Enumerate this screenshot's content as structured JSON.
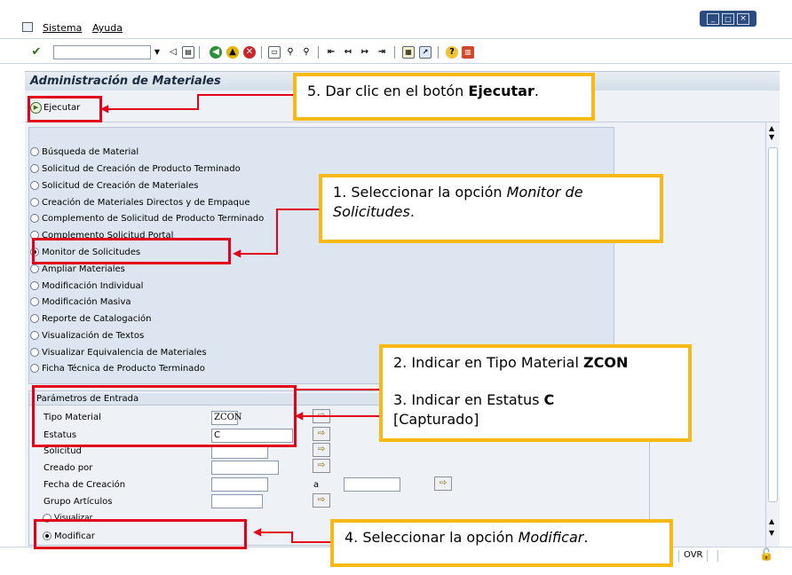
{
  "menu": {
    "sistema": "Sistema",
    "ayuda": "Ayuda"
  },
  "toolbar": {
    "command_placeholder": "",
    "icons": [
      "check-icon",
      "back-icon",
      "save-icon",
      "back-green-icon",
      "exit-icon",
      "cancel-icon",
      "print-icon",
      "find-icon",
      "find-next-icon",
      "first-page-icon",
      "prev-page-icon",
      "next-page-icon",
      "last-page-icon",
      "new-session-icon",
      "shortcut-icon",
      "help-icon",
      "layout-icon"
    ]
  },
  "title": "Administración de Materiales",
  "execute_label": "Ejecutar",
  "options": [
    "Búsqueda de Material",
    "Solicitud de Creación de Producto Terminado",
    "Solicitud de Creación de Materiales",
    "Creación de Materiales Directos y de Empaque",
    "Complemento de Solicitud de Producto Terminado",
    "Complemento Solicitud Portal",
    "Monitor de Solicitudes",
    "Ampliar Materiales",
    "Modificación Individual",
    "Modificación Masiva",
    "Reporte de Catalogación",
    "Visualización de Textos",
    "Visualizar Equivalencia de Materiales",
    "Ficha Técnica de Producto Terminado"
  ],
  "params": {
    "header": "Parámetros de Entrada",
    "tipo_label": "Tipo Material",
    "tipo_value": "ZCON",
    "estatus_label": "Estatus",
    "estatus_value": "C",
    "solicitud_label": "Solicitud",
    "creado_label": "Creado por",
    "fecha_label": "Fecha de Creación",
    "fecha_to": "a",
    "grupo_label": "Grupo Artículos",
    "visualizar_label": "Visualizar",
    "modificar_label": "Modificar"
  },
  "status_bar": {
    "ovr": "OVR"
  },
  "callouts": {
    "c5_pre": "5. Dar clic en el botón ",
    "c5_bold": "Ejecutar",
    "c5_post": ".",
    "c1_num": "1",
    "c1_pre": ". Seleccionar la opción ",
    "c1_it": "Monitor de Solicitudes",
    "c1_post": ".",
    "c2_pre": "2. Indicar en Tipo Material ",
    "c2_bold": "ZCON",
    "c3_pre": "3. Indicar en Estatus ",
    "c3_bold": "C",
    "c3_cont": "[Capturado]",
    "c4_pre": "4. Seleccionar la opción ",
    "c4_it": "Modificar",
    "c4_post": "."
  },
  "colors": {
    "accent_yellow": "#f6b915",
    "annotation_red": "#e3001b",
    "title_bar": "#dfe6ef",
    "panel": "#dde6f0"
  }
}
